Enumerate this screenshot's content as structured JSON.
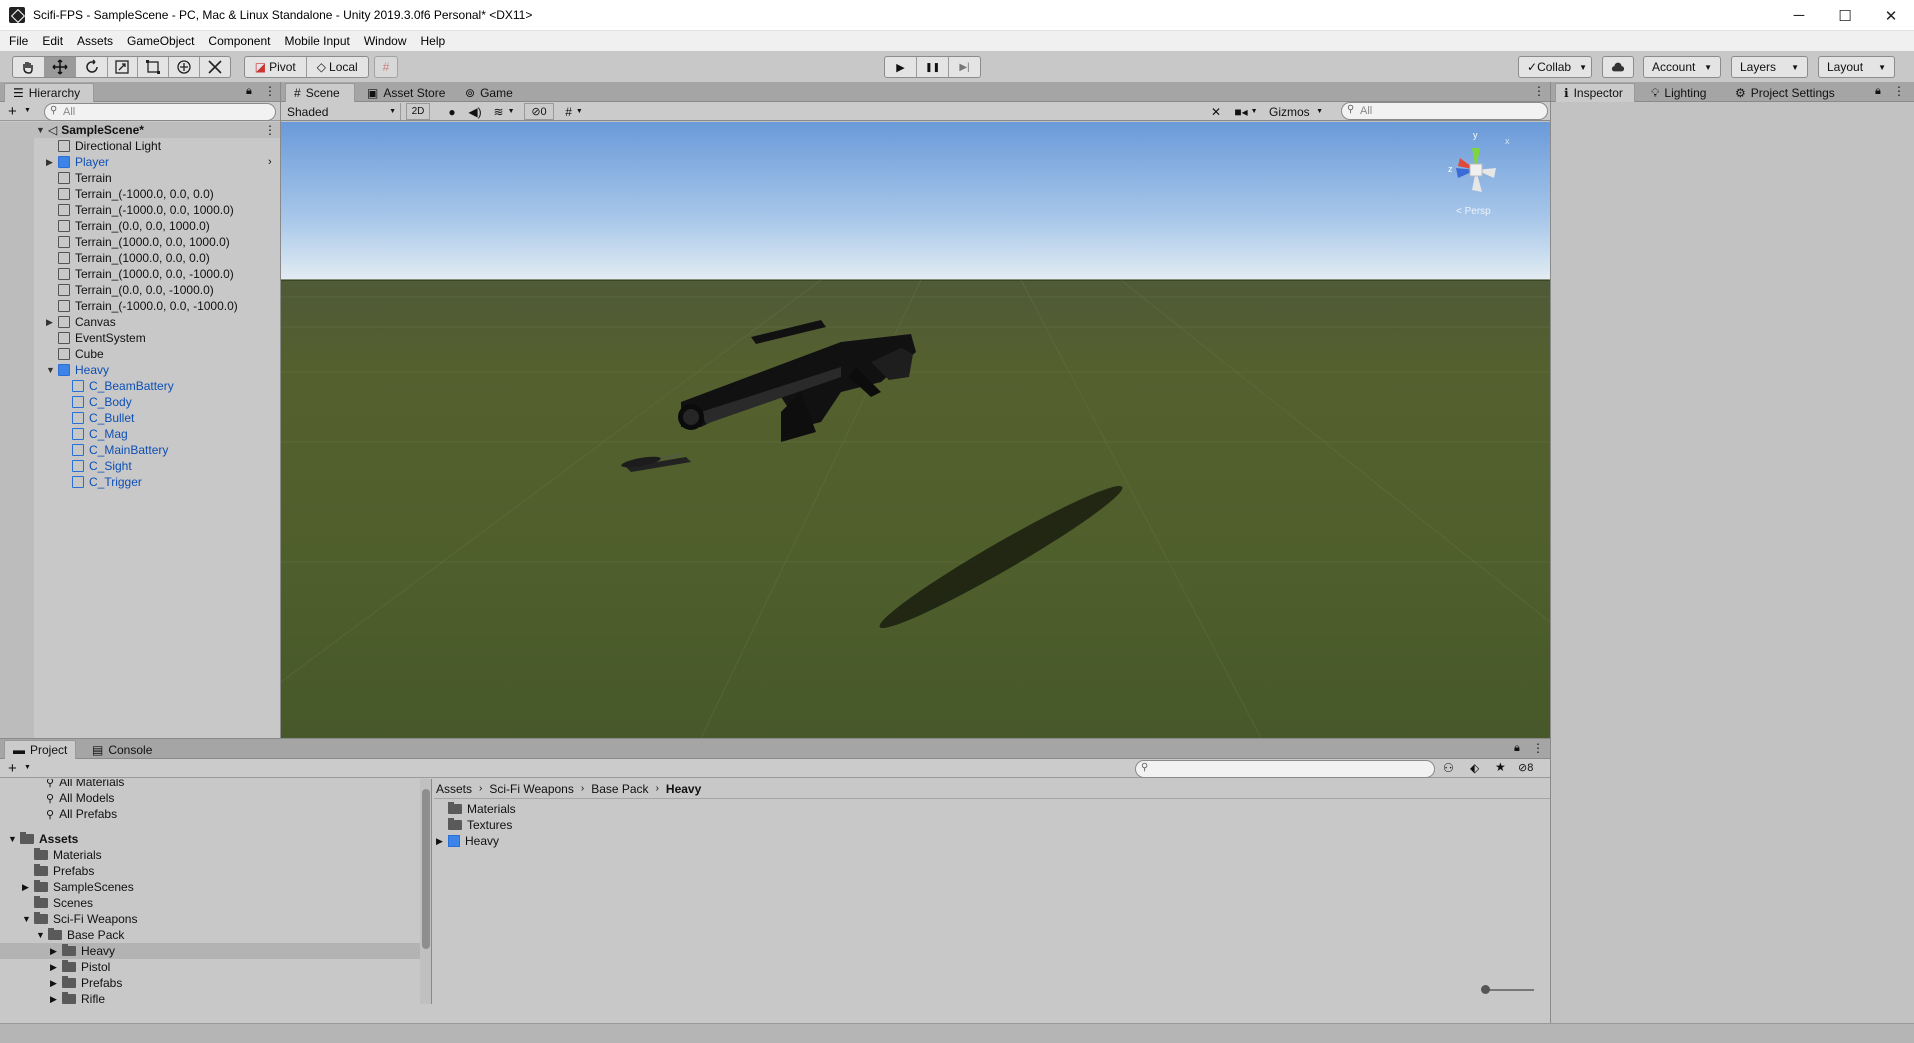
{
  "window": {
    "title": "Scifi-FPS - SampleScene - PC, Mac & Linux Standalone - Unity 2019.3.0f6 Personal* <DX11>",
    "minimize": "─",
    "maximize": "☐",
    "close": "✕"
  },
  "menu": [
    "File",
    "Edit",
    "Assets",
    "GameObject",
    "Component",
    "Mobile Input",
    "Window",
    "Help"
  ],
  "toolbar": {
    "tools": [
      "hand-icon",
      "move-icon",
      "rotate-icon",
      "scale-icon",
      "rect-icon",
      "transform-icon",
      "custom-tool-icon"
    ],
    "pivot": "Pivot",
    "local": "Local",
    "play": "▶",
    "pause": "❚❚",
    "step": "▶|",
    "collab": "Collab",
    "account": "Account",
    "layers": "Layers",
    "layout": "Layout"
  },
  "hierarchy": {
    "tab": "Hierarchy",
    "search_placeholder": "All",
    "scene": "SampleScene*",
    "items": [
      {
        "label": "Directional Light",
        "depth": 1,
        "prefab": false,
        "expand": ""
      },
      {
        "label": "Player",
        "depth": 1,
        "prefab": true,
        "expand": "▶"
      },
      {
        "label": "Terrain",
        "depth": 1,
        "prefab": false,
        "expand": ""
      },
      {
        "label": "Terrain_(-1000.0, 0.0, 0.0)",
        "depth": 1,
        "prefab": false,
        "expand": ""
      },
      {
        "label": "Terrain_(-1000.0, 0.0, 1000.0)",
        "depth": 1,
        "prefab": false,
        "expand": ""
      },
      {
        "label": "Terrain_(0.0, 0.0, 1000.0)",
        "depth": 1,
        "prefab": false,
        "expand": ""
      },
      {
        "label": "Terrain_(1000.0, 0.0, 1000.0)",
        "depth": 1,
        "prefab": false,
        "expand": ""
      },
      {
        "label": "Terrain_(1000.0, 0.0, 0.0)",
        "depth": 1,
        "prefab": false,
        "expand": ""
      },
      {
        "label": "Terrain_(1000.0, 0.0, -1000.0)",
        "depth": 1,
        "prefab": false,
        "expand": ""
      },
      {
        "label": "Terrain_(0.0, 0.0, -1000.0)",
        "depth": 1,
        "prefab": false,
        "expand": ""
      },
      {
        "label": "Terrain_(-1000.0, 0.0, -1000.0)",
        "depth": 1,
        "prefab": false,
        "expand": ""
      },
      {
        "label": "Canvas",
        "depth": 1,
        "prefab": false,
        "expand": "▶"
      },
      {
        "label": "EventSystem",
        "depth": 1,
        "prefab": false,
        "expand": ""
      },
      {
        "label": "Cube",
        "depth": 1,
        "prefab": false,
        "expand": ""
      },
      {
        "label": "Heavy",
        "depth": 1,
        "prefab": true,
        "expand": "▼"
      },
      {
        "label": "C_BeamBattery",
        "depth": 2,
        "prefab": true,
        "expand": ""
      },
      {
        "label": "C_Body",
        "depth": 2,
        "prefab": true,
        "expand": ""
      },
      {
        "label": "C_Bullet",
        "depth": 2,
        "prefab": true,
        "expand": ""
      },
      {
        "label": "C_Mag",
        "depth": 2,
        "prefab": true,
        "expand": ""
      },
      {
        "label": "C_MainBattery",
        "depth": 2,
        "prefab": true,
        "expand": ""
      },
      {
        "label": "C_Sight",
        "depth": 2,
        "prefab": true,
        "expand": ""
      },
      {
        "label": "C_Trigger",
        "depth": 2,
        "prefab": true,
        "expand": ""
      }
    ]
  },
  "scene": {
    "tabs": [
      "Scene",
      "Asset Store",
      "Game"
    ],
    "shading": "Shaded",
    "mode2d": "2D",
    "hidden_count": "0",
    "gizmos": "Gizmos",
    "search_placeholder": "All",
    "gizmo_label": "< Persp",
    "axis_x": "x",
    "axis_y": "y",
    "axis_z": "z"
  },
  "inspector": {
    "tabs": [
      "Inspector",
      "Lighting",
      "Project Settings"
    ]
  },
  "project": {
    "tabs": [
      "Project",
      "Console"
    ],
    "hidden_count": "8",
    "tree": [
      {
        "label": "All Materials",
        "type": "search",
        "depth": 1,
        "expand": ""
      },
      {
        "label": "All Models",
        "type": "search",
        "depth": 1,
        "expand": ""
      },
      {
        "label": "All Prefabs",
        "type": "search",
        "depth": 1,
        "expand": ""
      },
      {
        "label": "Assets",
        "type": "folder",
        "depth": 0,
        "expand": "▼",
        "bold": true
      },
      {
        "label": "Materials",
        "type": "folder",
        "depth": 1,
        "expand": ""
      },
      {
        "label": "Prefabs",
        "type": "folder",
        "depth": 1,
        "expand": ""
      },
      {
        "label": "SampleScenes",
        "type": "folder",
        "depth": 1,
        "expand": "▶"
      },
      {
        "label": "Scenes",
        "type": "folder",
        "depth": 1,
        "expand": ""
      },
      {
        "label": "Sci-Fi Weapons",
        "type": "folder",
        "depth": 1,
        "expand": "▼"
      },
      {
        "label": "Base Pack",
        "type": "folder",
        "depth": 2,
        "expand": "▼"
      },
      {
        "label": "Heavy",
        "type": "folder",
        "depth": 3,
        "expand": "▶",
        "selected": true
      },
      {
        "label": "Pistol",
        "type": "folder",
        "depth": 3,
        "expand": "▶"
      },
      {
        "label": "Prefabs",
        "type": "folder",
        "depth": 3,
        "expand": "▶"
      },
      {
        "label": "Rifle",
        "type": "folder",
        "depth": 3,
        "expand": "▶"
      }
    ],
    "breadcrumb": [
      "Assets",
      "Sci-Fi Weapons",
      "Base Pack",
      "Heavy"
    ],
    "contents": [
      {
        "label": "Materials",
        "type": "folder",
        "expand": ""
      },
      {
        "label": "Textures",
        "type": "folder",
        "expand": ""
      },
      {
        "label": "Heavy",
        "type": "prefab",
        "expand": "▶"
      }
    ]
  },
  "colors": {
    "accent_blue": "#3d84e8",
    "prefab_text": "#0d4fb6",
    "panel_bg": "#c8c8c8"
  }
}
